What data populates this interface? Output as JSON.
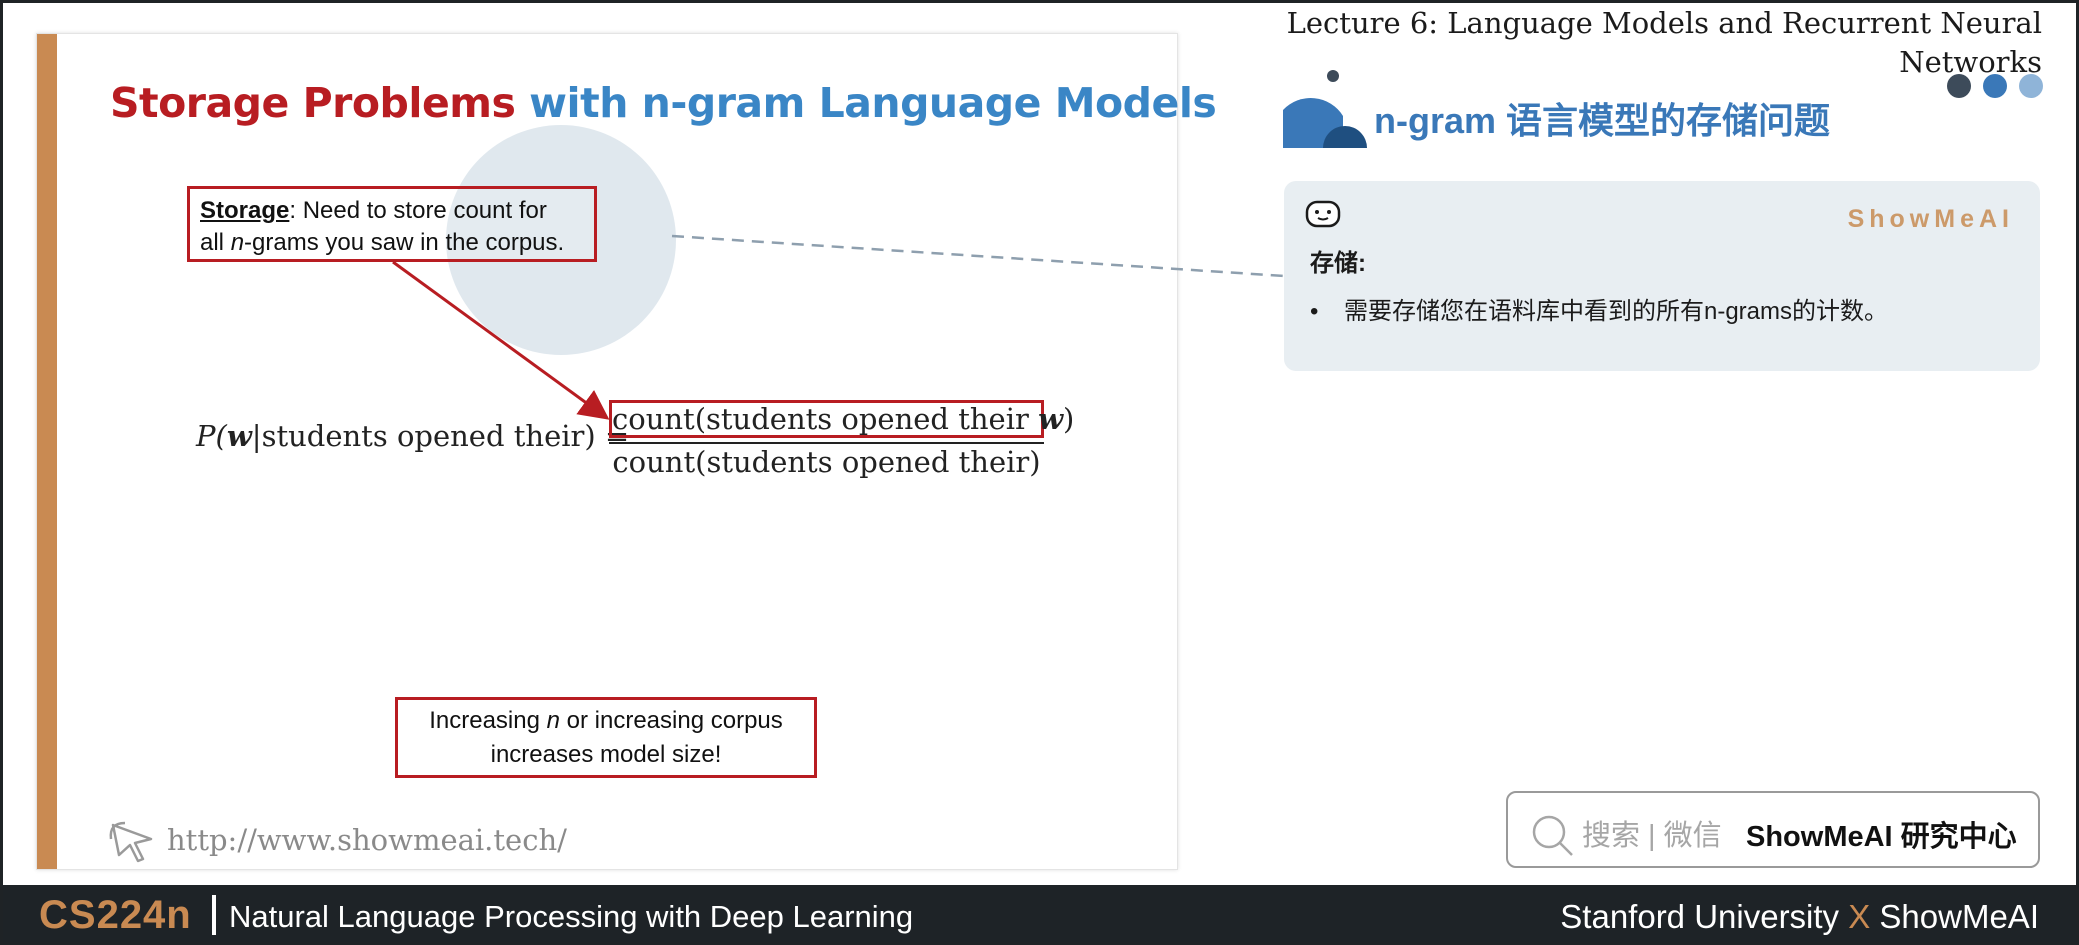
{
  "slide": {
    "title_red": "Storage Problems",
    "title_blue": " with n-gram Language Models",
    "storage_keyword": "Storage",
    "storage_line1_rest": ": Need to store count for",
    "storage_line2_pre": "all ",
    "storage_line2_n": "n",
    "storage_line2_rest": "-grams you saw in the corpus.",
    "formula_lhs_P": "P(",
    "formula_lhs_w": "w",
    "formula_lhs_rest": "|students opened their) =",
    "formula_numerator_text": "count(students opened their ",
    "formula_numerator_w": "w",
    "formula_numerator_close": ")",
    "formula_denominator": "count(students opened their)",
    "increase_pre": "Increasing ",
    "increase_n": "n",
    "increase_rest": " or increasing corpus",
    "increase_line2": "increases model size!",
    "url": "http://www.showmeai.tech/"
  },
  "header": {
    "lecture_line1": "Lecture 6:  Language Models and Recurrent Neural",
    "lecture_line2": "Networks",
    "section_title": "n-gram 语言模型的存储问题"
  },
  "note": {
    "brand": "ShowMeAI",
    "heading": "存储:",
    "bullet": "•",
    "item": "需要存储您在语料库中看到的所有n-grams的计数。"
  },
  "search": {
    "placeholder": "搜索 | 微信",
    "brand": "ShowMeAI 研究中心"
  },
  "footer": {
    "course_code": "CS224n",
    "course_name": "Natural Language Processing with Deep Learning",
    "credit_left": "Stanford University ",
    "credit_x": "X",
    "credit_right": " ShowMeAI"
  },
  "colors": {
    "red": "#b81d22",
    "blue": "#3a86c6",
    "accent_orange": "#c98a52",
    "dark_bar": "#1e2327"
  },
  "icons": [
    "cursor-icon",
    "robot-icon",
    "search-icon",
    "section-logo-icon"
  ]
}
